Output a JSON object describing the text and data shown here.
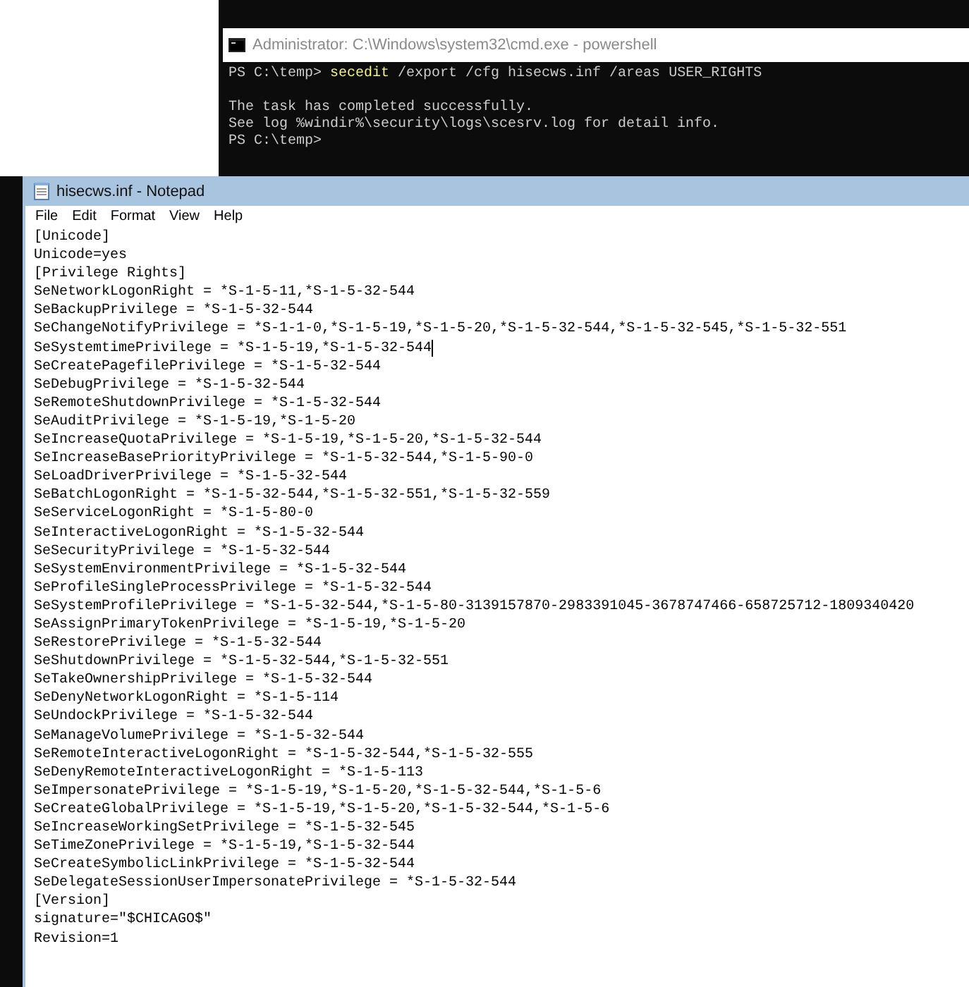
{
  "console": {
    "title": "Administrator: C:\\Windows\\system32\\cmd.exe - powershell",
    "lines": [
      {
        "kind": "command",
        "prompt": "PS C:\\temp>",
        "command": "secedit",
        "args": "/export /cfg hisecws.inf /areas USER_RIGHTS"
      },
      {
        "kind": "blank"
      },
      {
        "kind": "output",
        "text": "The task has completed successfully."
      },
      {
        "kind": "output",
        "text": "See log %windir%\\security\\logs\\scesrv.log for detail info."
      },
      {
        "kind": "prompt",
        "prompt": "PS C:\\temp>"
      }
    ]
  },
  "notepad": {
    "title": "hisecws.inf - Notepad",
    "menu": [
      "File",
      "Edit",
      "Format",
      "View",
      "Help"
    ],
    "lines": [
      {
        "text": "[Unicode]"
      },
      {
        "text": "Unicode=yes"
      },
      {
        "text": "[Privilege Rights]"
      },
      {
        "text": "SeNetworkLogonRight = *S-1-5-11,*S-1-5-32-544"
      },
      {
        "text": "SeBackupPrivilege = *S-1-5-32-544"
      },
      {
        "text": "SeChangeNotifyPrivilege = *S-1-1-0,*S-1-5-19,*S-1-5-20,*S-1-5-32-544,*S-1-5-32-545,*S-1-5-32-551"
      },
      {
        "text": "SeSystemtimePrivilege = *S-1-5-19,*S-1-5-32-544",
        "cursor": true
      },
      {
        "text": "SeCreatePagefilePrivilege = *S-1-5-32-544"
      },
      {
        "text": "SeDebugPrivilege = *S-1-5-32-544"
      },
      {
        "text": "SeRemoteShutdownPrivilege = *S-1-5-32-544"
      },
      {
        "text": "SeAuditPrivilege = *S-1-5-19,*S-1-5-20"
      },
      {
        "text": "SeIncreaseQuotaPrivilege = *S-1-5-19,*S-1-5-20,*S-1-5-32-544"
      },
      {
        "text": "SeIncreaseBasePriorityPrivilege = *S-1-5-32-544,*S-1-5-90-0"
      },
      {
        "text": "SeLoadDriverPrivilege = *S-1-5-32-544"
      },
      {
        "text": "SeBatchLogonRight = *S-1-5-32-544,*S-1-5-32-551,*S-1-5-32-559"
      },
      {
        "text": "SeServiceLogonRight = *S-1-5-80-0"
      },
      {
        "text": "SeInteractiveLogonRight = *S-1-5-32-544"
      },
      {
        "text": "SeSecurityPrivilege = *S-1-5-32-544"
      },
      {
        "text": "SeSystemEnvironmentPrivilege = *S-1-5-32-544"
      },
      {
        "text": "SeProfileSingleProcessPrivilege = *S-1-5-32-544"
      },
      {
        "text": "SeSystemProfilePrivilege = *S-1-5-32-544,*S-1-5-80-3139157870-2983391045-3678747466-658725712-1809340420"
      },
      {
        "text": "SeAssignPrimaryTokenPrivilege = *S-1-5-19,*S-1-5-20"
      },
      {
        "text": "SeRestorePrivilege = *S-1-5-32-544"
      },
      {
        "text": "SeShutdownPrivilege = *S-1-5-32-544,*S-1-5-32-551"
      },
      {
        "text": "SeTakeOwnershipPrivilege = *S-1-5-32-544"
      },
      {
        "text": "SeDenyNetworkLogonRight = *S-1-5-114"
      },
      {
        "text": "SeUndockPrivilege = *S-1-5-32-544"
      },
      {
        "text": "SeManageVolumePrivilege = *S-1-5-32-544"
      },
      {
        "text": "SeRemoteInteractiveLogonRight = *S-1-5-32-544,*S-1-5-32-555"
      },
      {
        "text": "SeDenyRemoteInteractiveLogonRight = *S-1-5-113"
      },
      {
        "text": "SeImpersonatePrivilege = *S-1-5-19,*S-1-5-20,*S-1-5-32-544,*S-1-5-6"
      },
      {
        "text": "SeCreateGlobalPrivilege = *S-1-5-19,*S-1-5-20,*S-1-5-32-544,*S-1-5-6"
      },
      {
        "text": "SeIncreaseWorkingSetPrivilege = *S-1-5-32-545"
      },
      {
        "text": "SeTimeZonePrivilege = *S-1-5-19,*S-1-5-32-544"
      },
      {
        "text": "SeCreateSymbolicLinkPrivilege = *S-1-5-32-544"
      },
      {
        "text": "SeDelegateSessionUserImpersonatePrivilege = *S-1-5-32-544"
      },
      {
        "text": "[Version]"
      },
      {
        "text": "signature=\"$CHICAGO$\""
      },
      {
        "text": "Revision=1"
      }
    ]
  }
}
